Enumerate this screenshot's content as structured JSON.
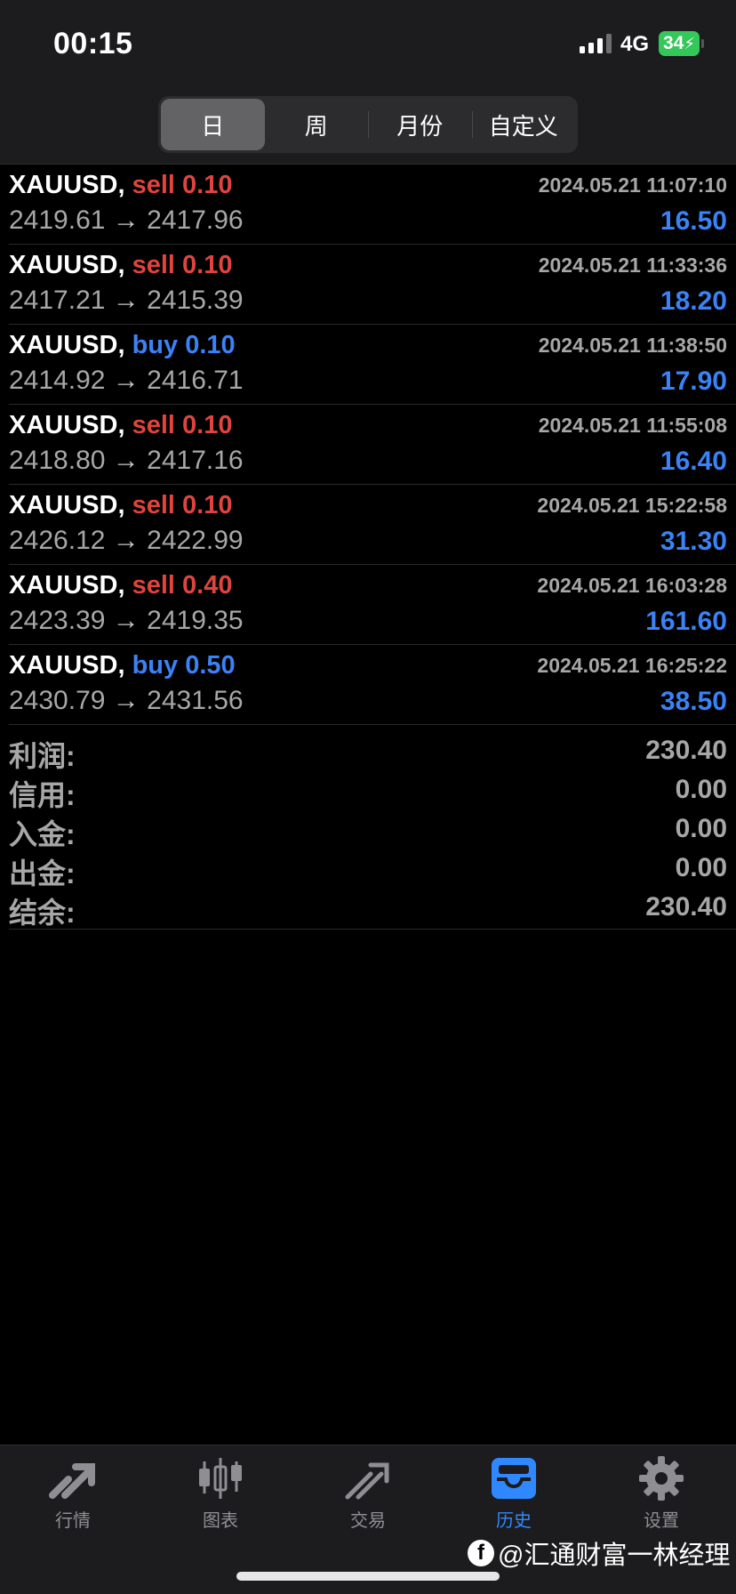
{
  "status_bar": {
    "time": "00:15",
    "network": "4G",
    "battery": "34"
  },
  "period_tabs": [
    {
      "label": "日",
      "active": true
    },
    {
      "label": "周",
      "active": false
    },
    {
      "label": "月份",
      "active": false
    },
    {
      "label": "自定义",
      "active": false
    }
  ],
  "deals": [
    {
      "symbol": "XAUUSD,",
      "type": "sell",
      "volume": "0.10",
      "time": "2024.05.21 11:07:10",
      "open": "2419.61",
      "arrow": "→",
      "close": "2417.96",
      "profit": "16.50"
    },
    {
      "symbol": "XAUUSD,",
      "type": "sell",
      "volume": "0.10",
      "time": "2024.05.21 11:33:36",
      "open": "2417.21",
      "arrow": "→",
      "close": "2415.39",
      "profit": "18.20"
    },
    {
      "symbol": "XAUUSD,",
      "type": "buy",
      "volume": "0.10",
      "time": "2024.05.21 11:38:50",
      "open": "2414.92",
      "arrow": "→",
      "close": "2416.71",
      "profit": "17.90"
    },
    {
      "symbol": "XAUUSD,",
      "type": "sell",
      "volume": "0.10",
      "time": "2024.05.21 11:55:08",
      "open": "2418.80",
      "arrow": "→",
      "close": "2417.16",
      "profit": "16.40"
    },
    {
      "symbol": "XAUUSD,",
      "type": "sell",
      "volume": "0.10",
      "time": "2024.05.21 15:22:58",
      "open": "2426.12",
      "arrow": "→",
      "close": "2422.99",
      "profit": "31.30"
    },
    {
      "symbol": "XAUUSD,",
      "type": "sell",
      "volume": "0.40",
      "time": "2024.05.21 16:03:28",
      "open": "2423.39",
      "arrow": "→",
      "close": "2419.35",
      "profit": "161.60"
    },
    {
      "symbol": "XAUUSD,",
      "type": "buy",
      "volume": "0.50",
      "time": "2024.05.21 16:25:22",
      "open": "2430.79",
      "arrow": "→",
      "close": "2431.56",
      "profit": "38.50"
    }
  ],
  "summary": [
    {
      "label": "利润:",
      "value": "230.40"
    },
    {
      "label": "信用:",
      "value": "0.00"
    },
    {
      "label": "入金:",
      "value": "0.00"
    },
    {
      "label": "出金:",
      "value": "0.00"
    },
    {
      "label": "结余:",
      "value": "230.40"
    }
  ],
  "tabbar": [
    {
      "label": "行情",
      "icon": "quotes-icon",
      "active": false
    },
    {
      "label": "图表",
      "icon": "chart-candles-icon",
      "active": false
    },
    {
      "label": "交易",
      "icon": "trade-icon",
      "active": false
    },
    {
      "label": "历史",
      "icon": "history-inbox-icon",
      "active": true
    },
    {
      "label": "设置",
      "icon": "settings-gear-icon",
      "active": false
    }
  ],
  "watermark": {
    "text": "@汇通财富一林经理",
    "icon": "facebook-icon"
  },
  "colors": {
    "sell": "#e0443e",
    "buy": "#3b82f6",
    "profit": "#3b82f6",
    "active_tab": "#2f88ff"
  }
}
